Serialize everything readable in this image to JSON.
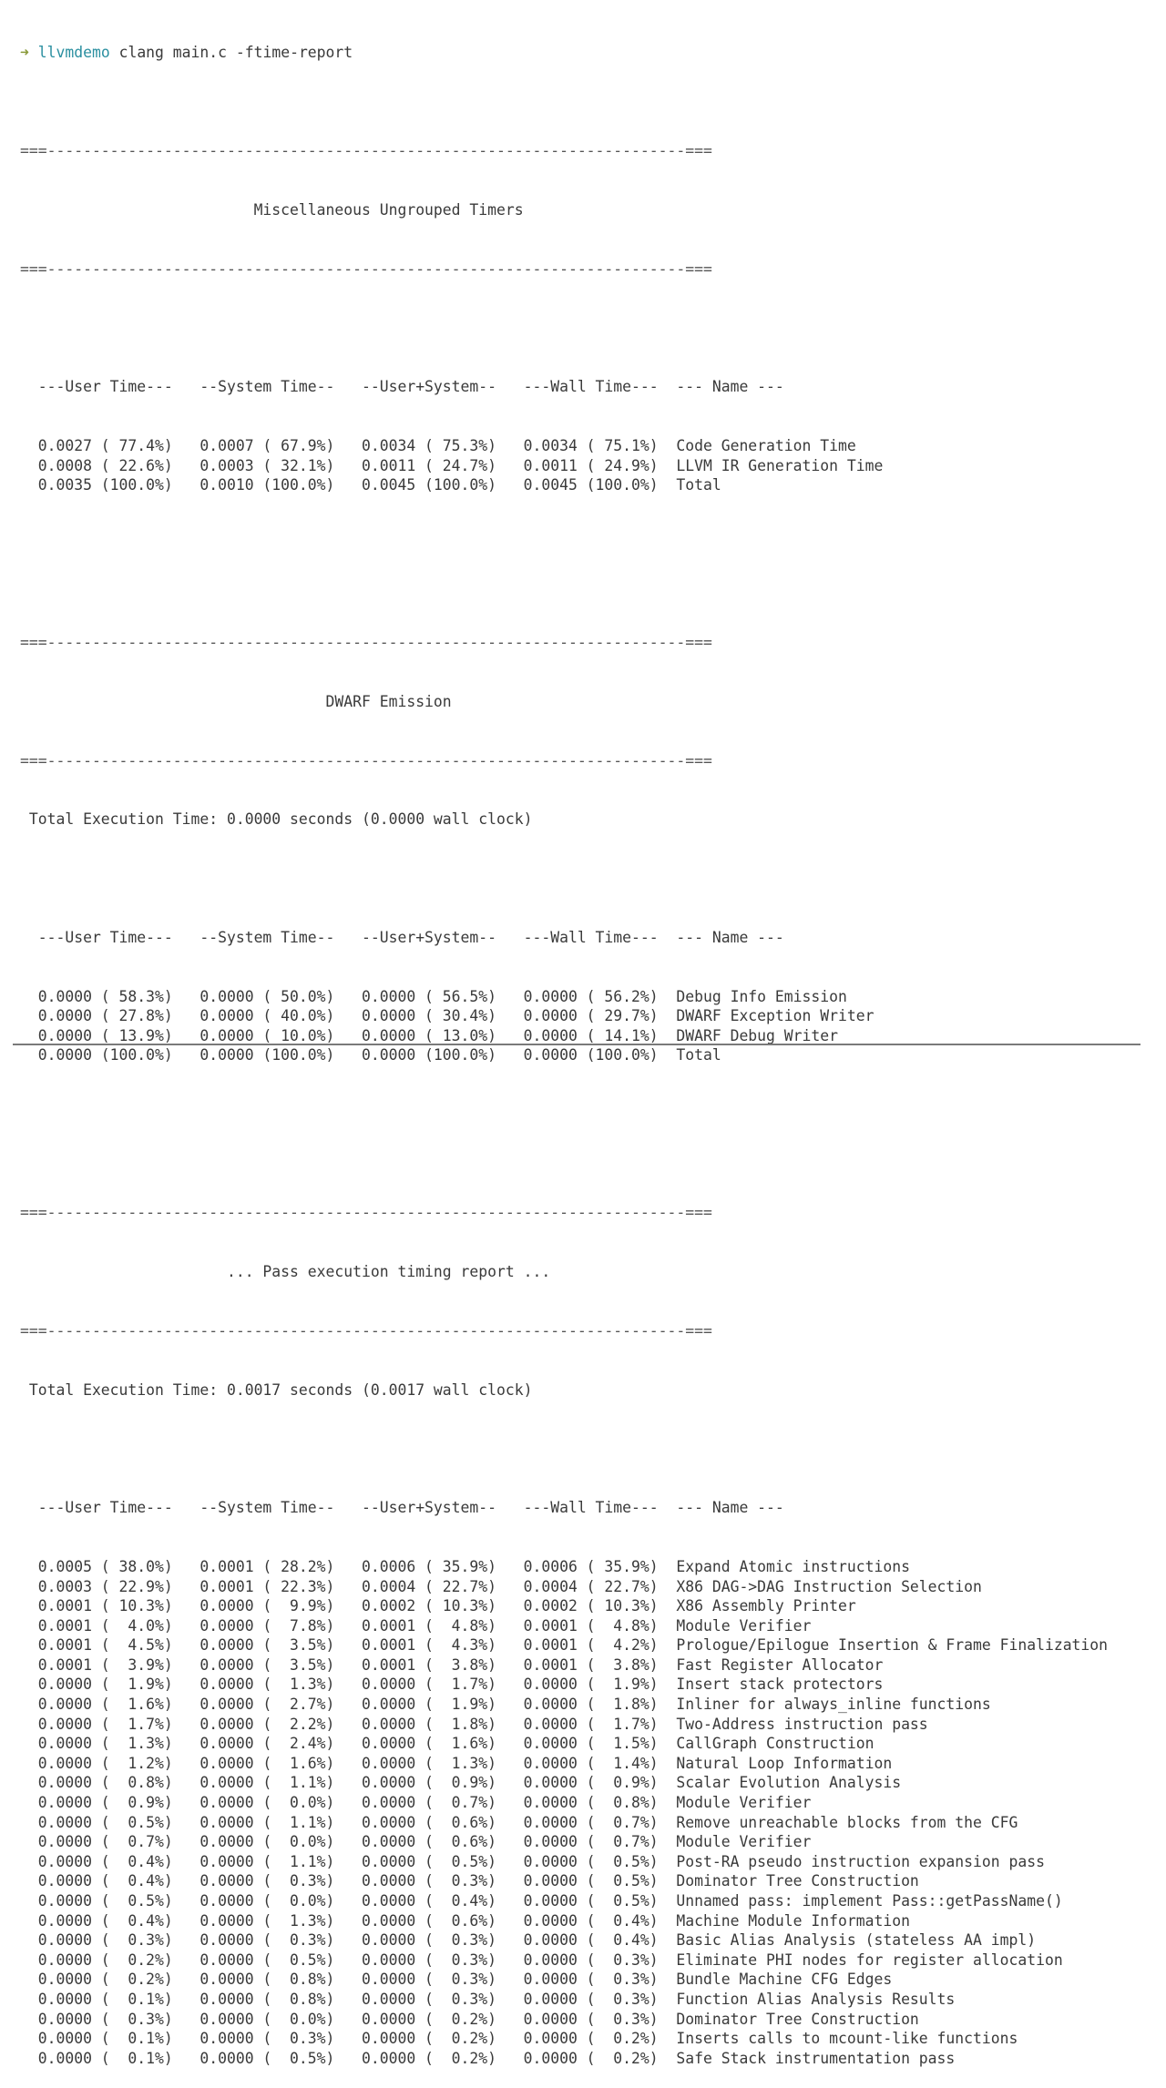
{
  "prompt": {
    "arrow": "➜",
    "dir": "llvmdemo",
    "command": "clang main.c -ftime-report"
  },
  "separator": "===-----------------------------------------------------------------------===",
  "sections": [
    {
      "title": "                          Miscellaneous Ungrouped Timers",
      "total_line": null,
      "header": "  ---User Time---   --System Time--   --User+System--   ---Wall Time---  --- Name ---",
      "rows": [
        "  0.0027 ( 77.4%)   0.0007 ( 67.9%)   0.0034 ( 75.3%)   0.0034 ( 75.1%)  Code Generation Time",
        "  0.0008 ( 22.6%)   0.0003 ( 32.1%)   0.0011 ( 24.7%)   0.0011 ( 24.9%)  LLVM IR Generation Time",
        "  0.0035 (100.0%)   0.0010 (100.0%)   0.0045 (100.0%)   0.0045 (100.0%)  Total"
      ]
    },
    {
      "title": "                                  DWARF Emission",
      "total_line": " Total Execution Time: 0.0000 seconds (0.0000 wall clock)",
      "header": "  ---User Time---   --System Time--   --User+System--   ---Wall Time---  --- Name ---",
      "rows": [
        "  0.0000 ( 58.3%)   0.0000 ( 50.0%)   0.0000 ( 56.5%)   0.0000 ( 56.2%)  Debug Info Emission",
        "  0.0000 ( 27.8%)   0.0000 ( 40.0%)   0.0000 ( 30.4%)   0.0000 ( 29.7%)  DWARF Exception Writer",
        "  0.0000 ( 13.9%)   0.0000 ( 10.0%)   0.0000 ( 13.0%)   0.0000 ( 14.1%)  DWARF Debug Writer",
        "  0.0000 (100.0%)   0.0000 (100.0%)   0.0000 (100.0%)   0.0000 (100.0%)  Total"
      ]
    },
    {
      "title": "                       ... Pass execution timing report ...",
      "total_line": " Total Execution Time: 0.0017 seconds (0.0017 wall clock)",
      "header": "  ---User Time---   --System Time--   --User+System--   ---Wall Time---  --- Name ---",
      "rows": [
        "  0.0005 ( 38.0%)   0.0001 ( 28.2%)   0.0006 ( 35.9%)   0.0006 ( 35.9%)  Expand Atomic instructions",
        "  0.0003 ( 22.9%)   0.0001 ( 22.3%)   0.0004 ( 22.7%)   0.0004 ( 22.7%)  X86 DAG->DAG Instruction Selection",
        "  0.0001 ( 10.3%)   0.0000 (  9.9%)   0.0002 ( 10.3%)   0.0002 ( 10.3%)  X86 Assembly Printer",
        "  0.0001 (  4.0%)   0.0000 (  7.8%)   0.0001 (  4.8%)   0.0001 (  4.8%)  Module Verifier",
        "  0.0001 (  4.5%)   0.0000 (  3.5%)   0.0001 (  4.3%)   0.0001 (  4.2%)  Prologue/Epilogue Insertion & Frame Finalization",
        "  0.0001 (  3.9%)   0.0000 (  3.5%)   0.0001 (  3.8%)   0.0001 (  3.8%)  Fast Register Allocator",
        "  0.0000 (  1.9%)   0.0000 (  1.3%)   0.0000 (  1.7%)   0.0000 (  1.9%)  Insert stack protectors",
        "  0.0000 (  1.6%)   0.0000 (  2.7%)   0.0000 (  1.9%)   0.0000 (  1.8%)  Inliner for always_inline functions",
        "  0.0000 (  1.7%)   0.0000 (  2.2%)   0.0000 (  1.8%)   0.0000 (  1.7%)  Two-Address instruction pass",
        "  0.0000 (  1.3%)   0.0000 (  2.4%)   0.0000 (  1.6%)   0.0000 (  1.5%)  CallGraph Construction",
        "  0.0000 (  1.2%)   0.0000 (  1.6%)   0.0000 (  1.3%)   0.0000 (  1.4%)  Natural Loop Information",
        "  0.0000 (  0.8%)   0.0000 (  1.1%)   0.0000 (  0.9%)   0.0000 (  0.9%)  Scalar Evolution Analysis",
        "  0.0000 (  0.9%)   0.0000 (  0.0%)   0.0000 (  0.7%)   0.0000 (  0.8%)  Module Verifier",
        "  0.0000 (  0.5%)   0.0000 (  1.1%)   0.0000 (  0.6%)   0.0000 (  0.7%)  Remove unreachable blocks from the CFG",
        "  0.0000 (  0.7%)   0.0000 (  0.0%)   0.0000 (  0.6%)   0.0000 (  0.7%)  Module Verifier",
        "  0.0000 (  0.4%)   0.0000 (  1.1%)   0.0000 (  0.5%)   0.0000 (  0.5%)  Post-RA pseudo instruction expansion pass",
        "  0.0000 (  0.4%)   0.0000 (  0.3%)   0.0000 (  0.3%)   0.0000 (  0.5%)  Dominator Tree Construction",
        "  0.0000 (  0.5%)   0.0000 (  0.0%)   0.0000 (  0.4%)   0.0000 (  0.5%)  Unnamed pass: implement Pass::getPassName()",
        "  0.0000 (  0.4%)   0.0000 (  1.3%)   0.0000 (  0.6%)   0.0000 (  0.4%)  Machine Module Information",
        "  0.0000 (  0.3%)   0.0000 (  0.3%)   0.0000 (  0.3%)   0.0000 (  0.4%)  Basic Alias Analysis (stateless AA impl)",
        "  0.0000 (  0.2%)   0.0000 (  0.5%)   0.0000 (  0.3%)   0.0000 (  0.3%)  Eliminate PHI nodes for register allocation",
        "  0.0000 (  0.2%)   0.0000 (  0.8%)   0.0000 (  0.3%)   0.0000 (  0.3%)  Bundle Machine CFG Edges",
        "  0.0000 (  0.1%)   0.0000 (  0.8%)   0.0000 (  0.3%)   0.0000 (  0.3%)  Function Alias Analysis Results",
        "  0.0000 (  0.3%)   0.0000 (  0.0%)   0.0000 (  0.2%)   0.0000 (  0.3%)  Dominator Tree Construction",
        "  0.0000 (  0.1%)   0.0000 (  0.3%)   0.0000 (  0.2%)   0.0000 (  0.2%)  Inserts calls to mcount-like functions",
        "  0.0000 (  0.1%)   0.0000 (  0.5%)   0.0000 (  0.2%)   0.0000 (  0.2%)  Safe Stack instrumentation pass"
      ]
    }
  ],
  "colors": {
    "background": "#ffffff",
    "text": "#3a3a3a",
    "prompt_arrow": "#8a9a3a",
    "prompt_dir": "#2a8fa0"
  }
}
